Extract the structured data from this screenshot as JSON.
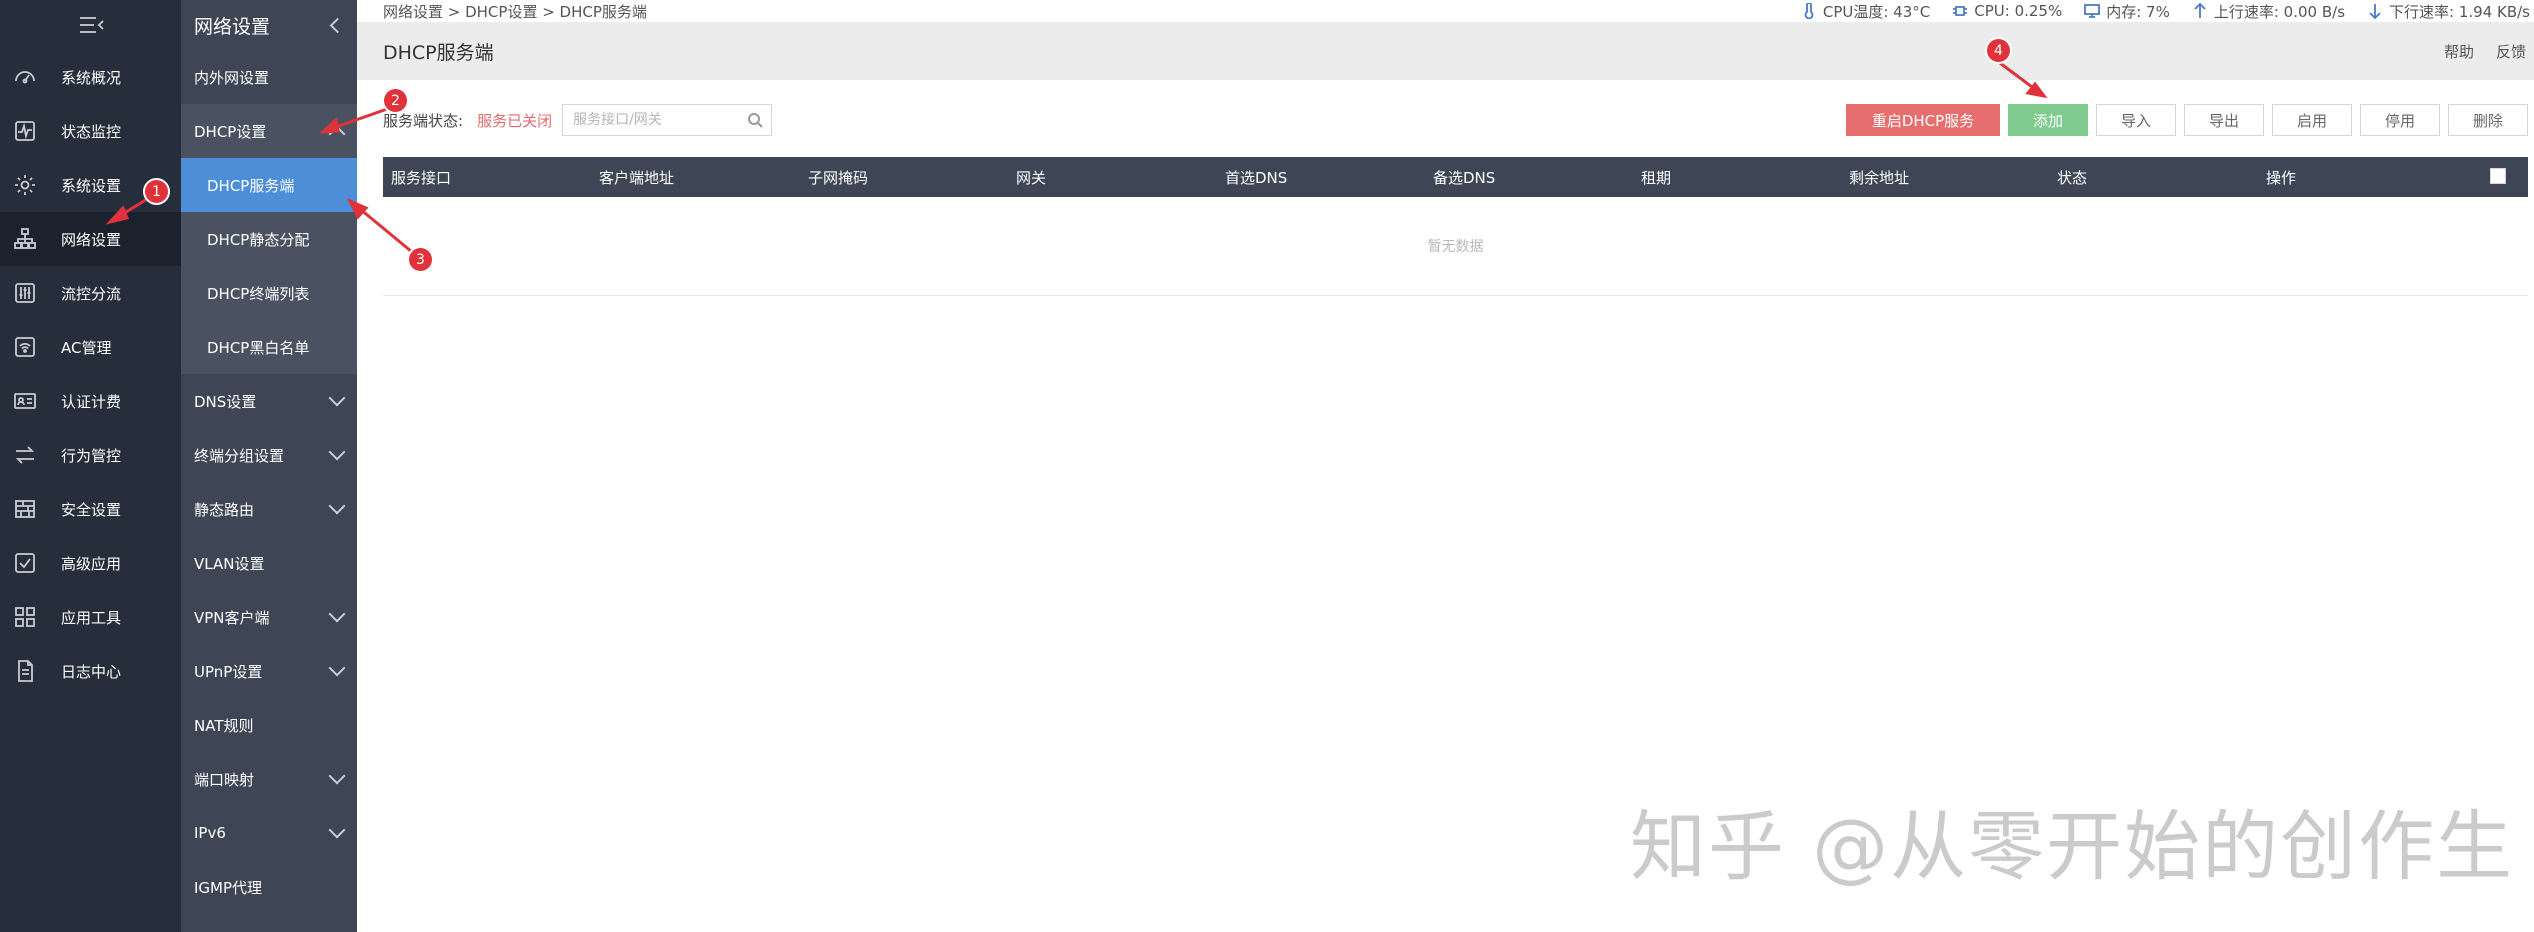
{
  "sidebar": {
    "items": [
      {
        "label": "系统概况",
        "icon": "dashboard-icon"
      },
      {
        "label": "状态监控",
        "icon": "pulse-icon"
      },
      {
        "label": "系统设置",
        "icon": "gear-icon"
      },
      {
        "label": "网络设置",
        "icon": "network-icon"
      },
      {
        "label": "流控分流",
        "icon": "sliders-icon"
      },
      {
        "label": "AC管理",
        "icon": "wifi-icon"
      },
      {
        "label": "认证计费",
        "icon": "id-card-icon"
      },
      {
        "label": "行为管控",
        "icon": "swap-icon"
      },
      {
        "label": "安全设置",
        "icon": "firewall-icon"
      },
      {
        "label": "高级应用",
        "icon": "checkbox-icon"
      },
      {
        "label": "应用工具",
        "icon": "apps-icon"
      },
      {
        "label": "日志中心",
        "icon": "document-icon"
      }
    ]
  },
  "submenu": {
    "title": "网络设置",
    "items": [
      {
        "label": "内外网设置"
      },
      {
        "label": "DHCP设置"
      },
      {
        "label": "DHCP服务端"
      },
      {
        "label": "DHCP静态分配"
      },
      {
        "label": "DHCP终端列表"
      },
      {
        "label": "DHCP黑白名单"
      },
      {
        "label": "DNS设置"
      },
      {
        "label": "终端分组设置"
      },
      {
        "label": "静态路由"
      },
      {
        "label": "VLAN设置"
      },
      {
        "label": "VPN客户端"
      },
      {
        "label": "UPnP设置"
      },
      {
        "label": "NAT规则"
      },
      {
        "label": "端口映射"
      },
      {
        "label": "IPv6"
      },
      {
        "label": "IGMP代理"
      }
    ]
  },
  "topbar": {
    "breadcrumb": "网络设置 > DHCP设置 > DHCP服务端",
    "cpu_temp": "CPU温度: 43°C",
    "cpu": "CPU: 0.25%",
    "memory": "内存: 7%",
    "upload": "上行速率: 0.00 B/s",
    "download": "下行速率: 1.94 KB/s"
  },
  "titlebar": {
    "title": "DHCP服务端",
    "help": "帮助",
    "feedback": "反馈"
  },
  "toolbar": {
    "status_label": "服务端状态:",
    "status_value": "服务已关闭",
    "search_placeholder": "服务接口/网关",
    "restart": "重启DHCP服务",
    "add": "添加",
    "import": "导入",
    "export": "导出",
    "enable": "启用",
    "disable": "停用",
    "delete": "删除"
  },
  "table": {
    "columns": [
      "服务接口",
      "客户端地址",
      "子网掩码",
      "网关",
      "首选DNS",
      "备选DNS",
      "租期",
      "剩余地址",
      "状态",
      "操作"
    ],
    "empty_text": "暂无数据"
  },
  "annotations": {
    "badges": [
      "1",
      "2",
      "3",
      "4"
    ],
    "watermark": "知乎 @从零开始的创作生"
  },
  "colors": {
    "sidebar_bg": "#262d3b",
    "submenu_bg": "#3e4655",
    "selected": "#4c8ed8",
    "danger": "#e66e6e",
    "success": "#7ecb8d",
    "badge": "#e0323a"
  }
}
